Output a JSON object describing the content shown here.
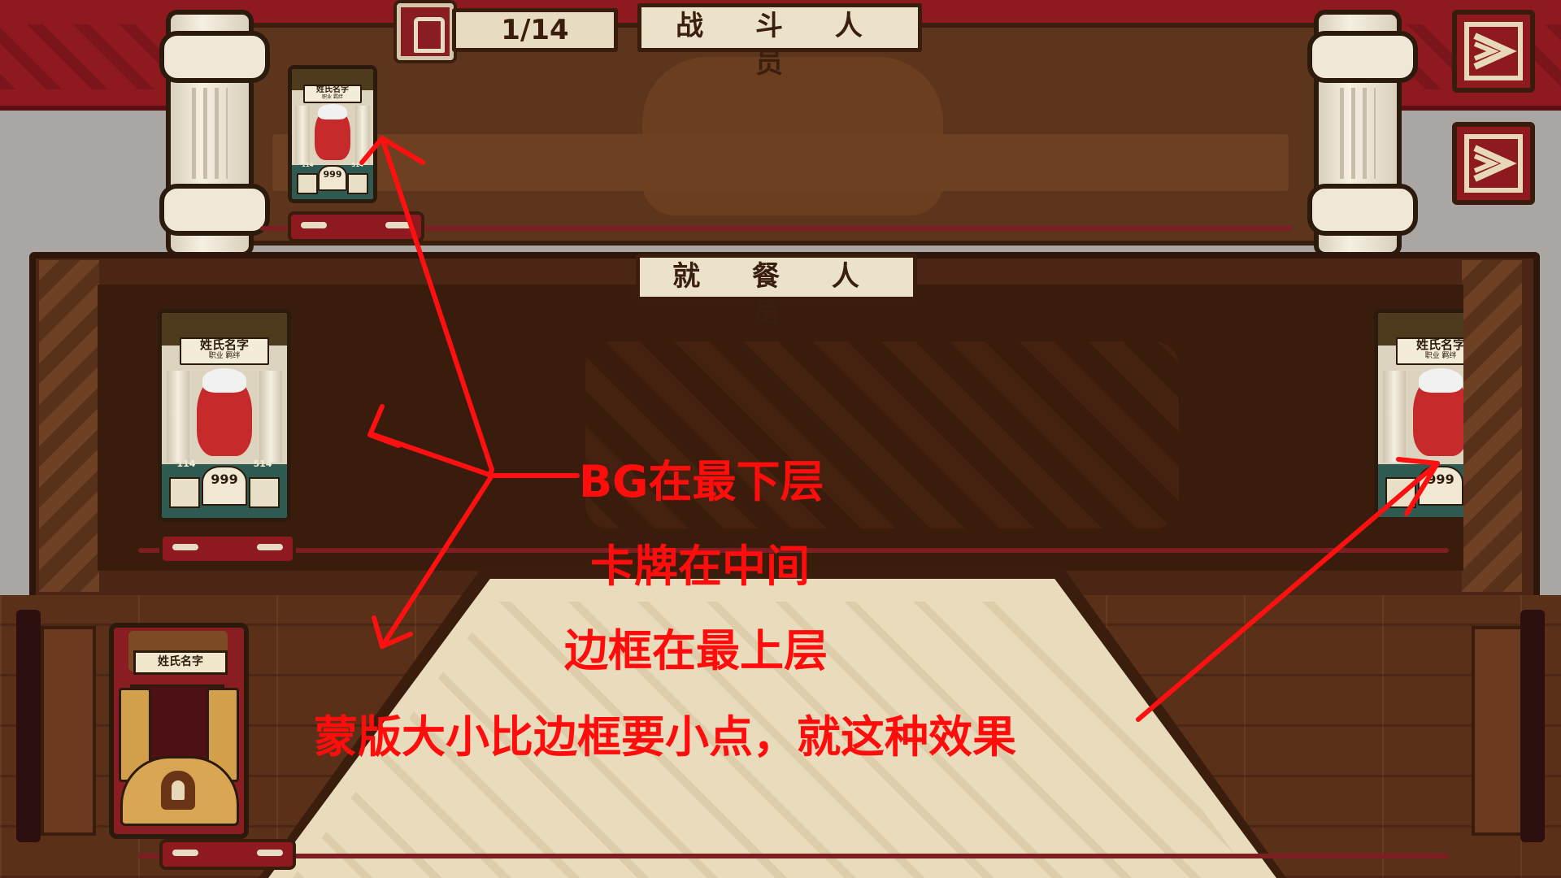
{
  "combat_section": {
    "title": "战 斗 人 员",
    "counter": "1/14",
    "counter_icon": "party-member-icon"
  },
  "dining_section": {
    "title": "就 餐 人 员"
  },
  "cards": {
    "name": "姓氏名字",
    "subtitle": "职业 羁绊",
    "stat_center": "999",
    "stat_left": "114",
    "stat_right": "514"
  },
  "locked_card": {
    "name": "姓氏名字",
    "icon": "lock-icon"
  },
  "nav_buttons": [
    "next-arrow-icon",
    "next-arrow-icon"
  ],
  "annotations": {
    "line1": "BG在最下层",
    "line2": "卡牌在中间",
    "line3": "边框在最上层",
    "line4": "蒙版大小比边框要小点，就这种效果"
  },
  "colors": {
    "banner_red": "#8e1a1f",
    "panel_brown": "#5d351c",
    "annotation_red": "#ff0d0d",
    "parchment": "#ece2c9"
  }
}
